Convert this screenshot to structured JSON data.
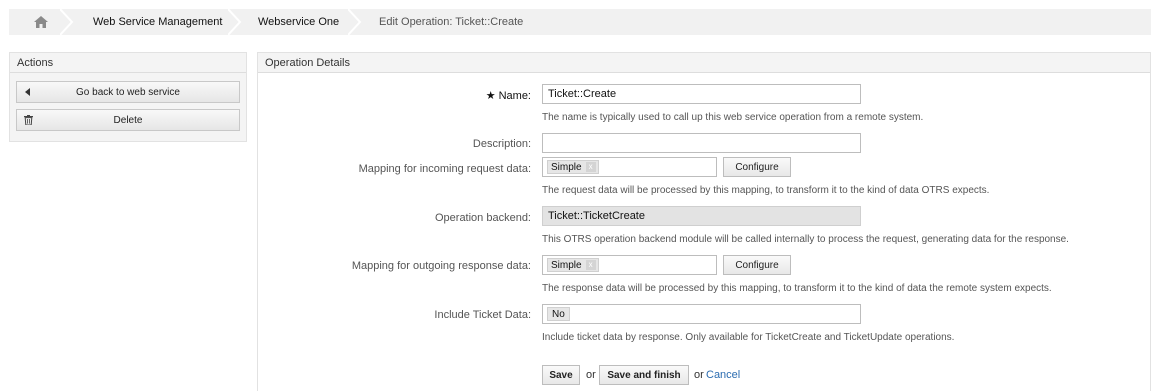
{
  "breadcrumb": {
    "home_icon": "home-icon",
    "items": [
      "Web Service Management",
      "Webservice One",
      "Edit Operation: Ticket::Create"
    ]
  },
  "sidebar": {
    "title": "Actions",
    "buttons": [
      {
        "label": "Go back to web service",
        "icon": "caret-left-icon"
      },
      {
        "label": "Delete",
        "icon": "trash-icon"
      }
    ]
  },
  "main": {
    "title": "Operation Details",
    "name": {
      "required_marker": "★",
      "label": "Name:",
      "value": "Ticket::Create",
      "hint": "The name is typically used to call up this web service operation from a remote system."
    },
    "description": {
      "label": "Description:",
      "value": ""
    },
    "incoming_mapping": {
      "label": "Mapping for incoming request data:",
      "value": "Simple",
      "remove": "x",
      "configure": "Configure",
      "hint": "The request data will be processed by this mapping, to transform it to the kind of data OTRS expects."
    },
    "backend": {
      "label": "Operation backend:",
      "value": "Ticket::TicketCreate",
      "hint": "This OTRS operation backend module will be called internally to process the request, generating data for the response."
    },
    "outgoing_mapping": {
      "label": "Mapping for outgoing response data:",
      "value": "Simple",
      "remove": "x",
      "configure": "Configure",
      "hint": "The response data will be processed by this mapping, to transform it to the kind of data the remote system expects."
    },
    "include_ticket_data": {
      "label": "Include Ticket Data:",
      "value": "No",
      "hint": "Include ticket data by response. Only available for TicketCreate and TicketUpdate operations."
    },
    "footer": {
      "save": "Save",
      "or1": "or",
      "save_finish": "Save and finish",
      "or2": "or",
      "cancel": "Cancel"
    }
  }
}
